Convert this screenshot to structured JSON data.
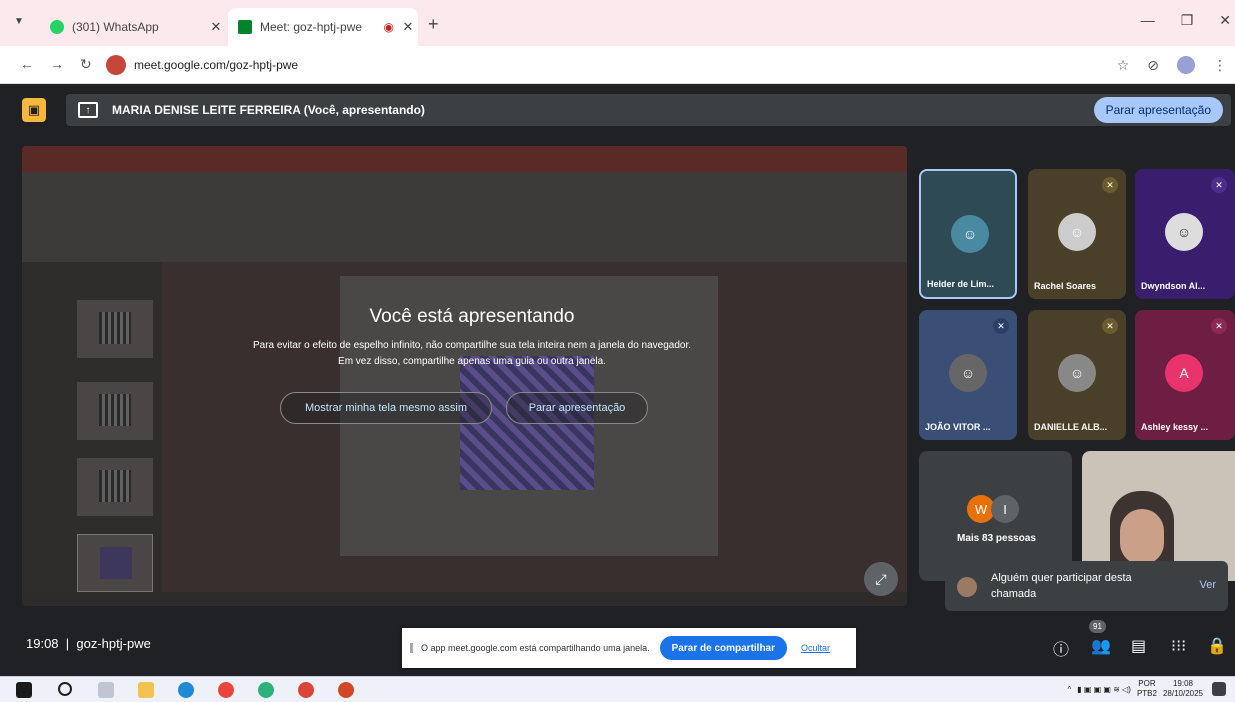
{
  "browser": {
    "tabs": [
      {
        "label": "(301) WhatsApp",
        "icon": "whatsapp-icon",
        "color": "#25d366"
      },
      {
        "label": "Meet: goz-hptj-pwe",
        "icon": "meet-icon",
        "color": "#00832d"
      }
    ],
    "url": "meet.google.com/goz-hptj-pwe"
  },
  "presenting": {
    "text": "MARIA DENISE LEITE FERREIRA (Você, apresentando)",
    "stop_label": "Parar apresentação"
  },
  "overlay": {
    "title": "Você está apresentando",
    "message": "Para evitar o efeito de espelho infinito, não compartilhe sua tela inteira nem a janela do navegador. Em vez disso, compartilhe apenas uma guia ou outra janela.",
    "show_anyway": "Mostrar minha tela mesmo assim",
    "stop": "Parar apresentação"
  },
  "participants": [
    {
      "name": "Helder de Lim...",
      "bg": "#2d4a55"
    },
    {
      "name": "Rachel Soares",
      "bg": "#4a3f28"
    },
    {
      "name": "Dwyndson Al...",
      "bg": "#3a1e6e"
    },
    {
      "name": "JOÃO VITOR ...",
      "bg": "#3b4f76"
    },
    {
      "name": "DANIELLE ALB...",
      "bg": "#4a3f28"
    },
    {
      "name": "Ashley kessy ...",
      "bg": "#6e1e42",
      "initial": "A"
    }
  ],
  "more": {
    "label": "Mais 83 pessoas",
    "initials": [
      "W",
      "I"
    ]
  },
  "toast": {
    "message": "Alguém quer participar desta chamada",
    "action": "Ver"
  },
  "meeting": {
    "time": "19:08",
    "code": "goz-hptj-pwe",
    "people_count": "91"
  },
  "share_banner": {
    "message": "O app meet.google.com está compartilhando uma janela.",
    "stop": "Parar de compartilhar",
    "hide": "Ocultar"
  },
  "taskbar": {
    "lang1": "POR",
    "lang2": "PTB2",
    "time": "19:08",
    "date": "28/10/2025"
  }
}
